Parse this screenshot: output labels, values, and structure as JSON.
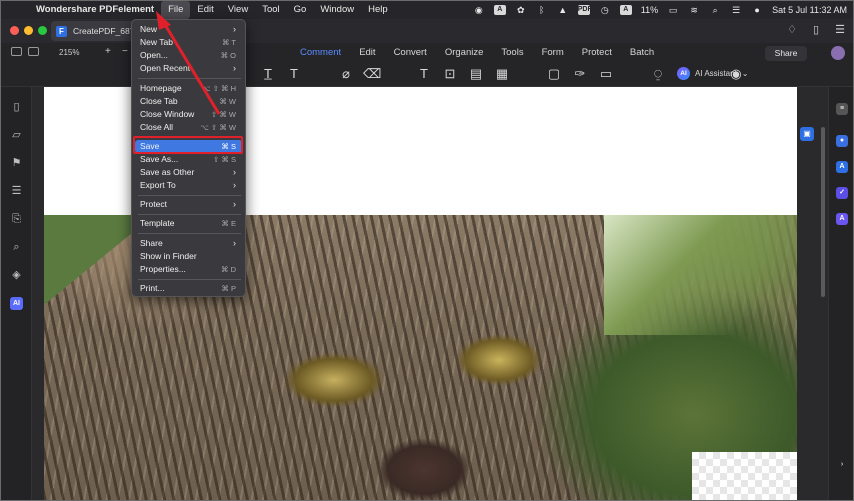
{
  "menubar": {
    "app_name": "Wondershare PDFelement",
    "items": [
      "File",
      "Edit",
      "View",
      "Tool",
      "Go",
      "Window",
      "Help"
    ],
    "battery": "11%",
    "datetime": "Sat 5 Jul  11:32 AM",
    "status_icons": [
      "screen-record-icon",
      "a-input-icon",
      "flower-icon",
      "bluetooth-icon",
      "vlc-icon",
      "pdf-icon",
      "clock-icon",
      "a-font-icon",
      "battery-icon",
      "wifi-icon",
      "search-icon",
      "control-center-icon",
      "siri-icon"
    ]
  },
  "tab": {
    "title": "CreatePDF_687c"
  },
  "toolbar": {
    "zoom": "215%",
    "nav": [
      "Comment",
      "Edit",
      "Convert",
      "Organize",
      "Tools",
      "Form",
      "Protect",
      "Batch"
    ],
    "active_nav": "Comment",
    "share": "Share",
    "ai_assistant": "AI Assistant"
  },
  "file_menu": {
    "new": "New",
    "new_tab": "New Tab",
    "new_tab_sc": "⌘ T",
    "open": "Open...",
    "open_sc": "⌘ O",
    "open_recent": "Open Recent",
    "homepage": "Homepage",
    "homepage_sc": "⌥ ⇧ ⌘ H",
    "close_tab": "Close Tab",
    "close_tab_sc": "⌘ W",
    "close_window": "Close Window",
    "close_window_sc": "⇧ ⌘ W",
    "close_all": "Close All",
    "close_all_sc": "⌥ ⇧ ⌘ W",
    "save": "Save",
    "save_sc": "⌘ S",
    "save_as": "Save As...",
    "save_as_sc": "⇧ ⌘ S",
    "save_as_other": "Save as Other",
    "export_to": "Export To",
    "protect": "Protect",
    "template": "Template",
    "template_sc": "⌘ E",
    "share": "Share",
    "show_in_finder": "Show in Finder",
    "properties": "Properties...",
    "properties_sc": "⌘ D",
    "print": "Print...",
    "print_sc": "⌘ P"
  },
  "colors": {
    "accent": "#3f78e0",
    "highlight_outline": "#e0202a",
    "brand": "#2f6fe4"
  }
}
